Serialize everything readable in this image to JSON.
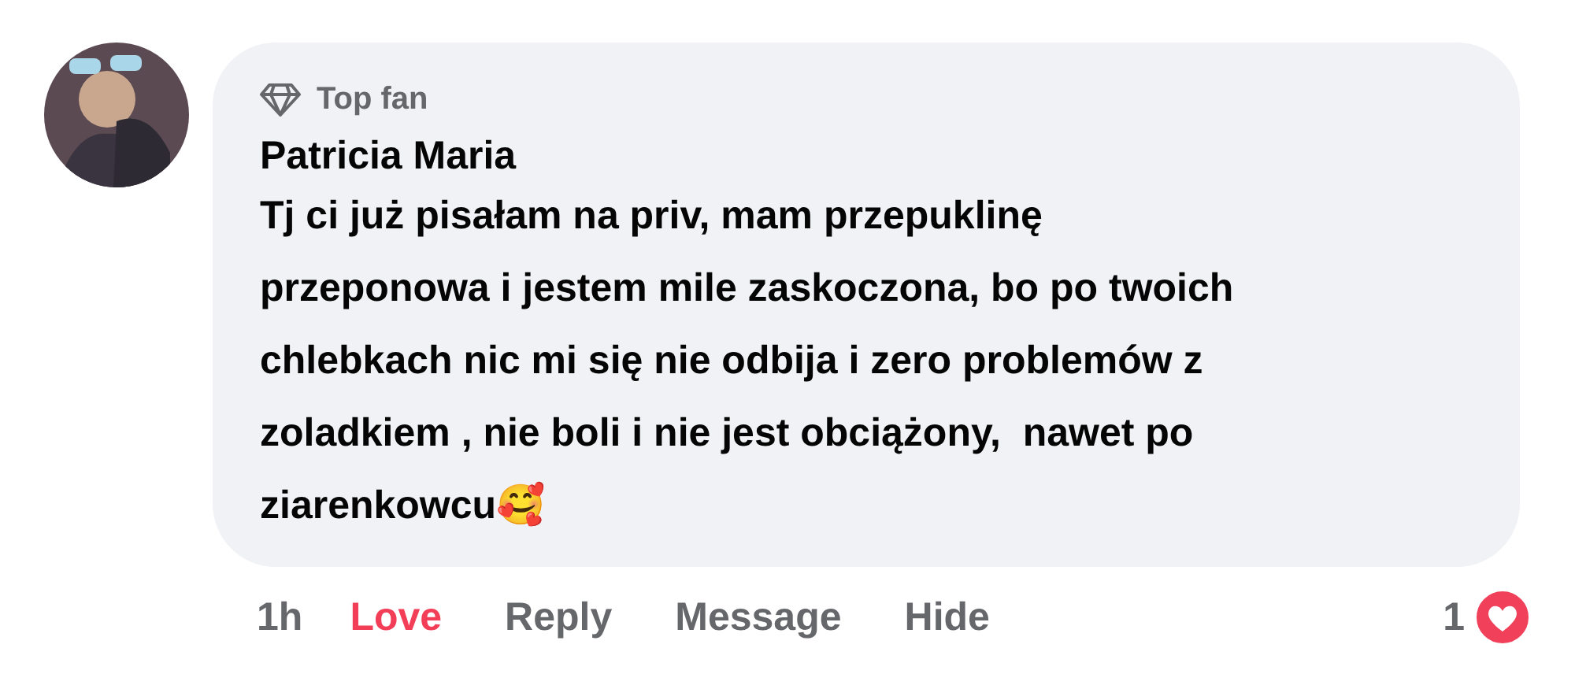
{
  "comment": {
    "badge": "Top fan",
    "author": "Patricia Maria",
    "lines": [
      "Tj ci już pisałam na priv, mam przepuklinę",
      "przeponowa i jestem mile zaskoczona, bo po twoich",
      "chlebkach nic mi się nie odbija i zero problemów z",
      "zoladkiem , nie boli i nie jest obciążony,  nawet po",
      "ziarenkowcu🥰"
    ]
  },
  "actions": [
    {
      "kind": "time",
      "label": "1h"
    },
    {
      "kind": "reaction",
      "label": "Love",
      "selected": true
    },
    {
      "kind": "link",
      "label": "Reply"
    },
    {
      "kind": "link",
      "label": "Message"
    },
    {
      "kind": "link",
      "label": "Hide"
    }
  ],
  "reactions": {
    "count": "1"
  }
}
